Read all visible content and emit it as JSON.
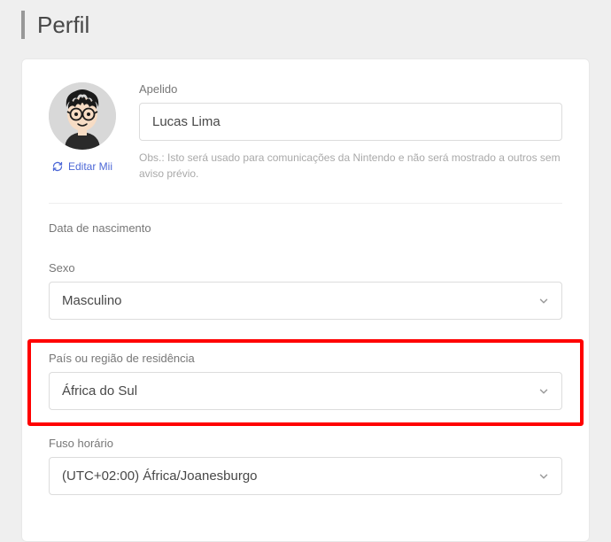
{
  "page": {
    "title": "Perfil"
  },
  "avatar": {
    "edit_label": "Editar Mii"
  },
  "nickname": {
    "label": "Apelido",
    "value": "Lucas Lima",
    "hint": "Obs.: Isto será usado para comunicações da Nintendo e não será mostrado a outros sem aviso prévio."
  },
  "dob": {
    "label": "Data de nascimento"
  },
  "gender": {
    "label": "Sexo",
    "value": "Masculino"
  },
  "country": {
    "label": "País ou região de residência",
    "value": "África do Sul"
  },
  "timezone": {
    "label": "Fuso horário",
    "value": "(UTC+02:00) África/Joanesburgo"
  }
}
